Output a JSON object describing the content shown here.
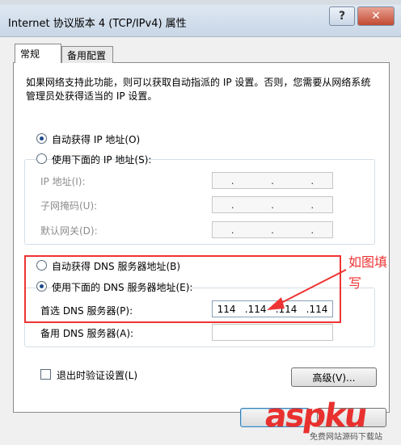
{
  "window": {
    "title": "Internet 协议版本 4 (TCP/IPv4) 属性",
    "help_glyph": "?",
    "close_glyph": "✕"
  },
  "tabs": [
    {
      "label": "常规"
    },
    {
      "label": "备用配置"
    }
  ],
  "description": "如果网络支持此功能，则可以获取自动指派的 IP 设置。否则，您需要从网络系统管理员处获得适当的 IP 设置。",
  "ip": {
    "auto_label": "自动获得 IP 地址(O)",
    "manual_label": "使用下面的 IP 地址(S):",
    "fields": [
      {
        "label": "IP 地址(I):"
      },
      {
        "label": "子网掩码(U):"
      },
      {
        "label": "默认网关(D):"
      }
    ],
    "empty_dots": "."
  },
  "dns": {
    "auto_label": "自动获得 DNS 服务器地址(B)",
    "manual_label": "使用下面的 DNS 服务器地址(E):",
    "preferred_label": "首选 DNS 服务器(P):",
    "preferred_value": [
      "114",
      ".114",
      ".114",
      ".114"
    ],
    "alternate_label": "备用 DNS 服务器(A):"
  },
  "validate_label": "退出时验证设置(L)",
  "advanced_label": "高级(V)...",
  "annotation": {
    "text": "如图填写"
  },
  "watermark": {
    "brand": "aspku",
    "sub": "免费网站源码下载站"
  },
  "colors": {
    "annotation": "#e33333",
    "accent": "#1c4a8c"
  }
}
